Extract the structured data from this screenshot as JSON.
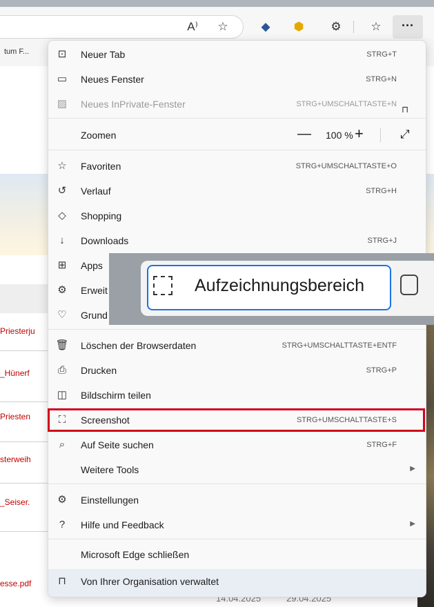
{
  "browser": {
    "favorite_item": "tum F...",
    "toolbar_icons": [
      "read-aloud-icon",
      "favorite-star-icon",
      "extension-icon",
      "extension-badge-icon",
      "extensions-icon",
      "favorites-icon"
    ],
    "more_label": "···"
  },
  "page": {
    "links": [
      "Priesterju",
      "_Hünerf",
      "Priesten",
      "sterweih",
      "_Seiser.",
      "esse.pdf"
    ],
    "dates": [
      "14.04.2025",
      "29.04.2025"
    ]
  },
  "menu": {
    "items": [
      {
        "label": "Neuer Tab",
        "shortcut": "STRG+T",
        "icon": "new-tab-icon"
      },
      {
        "label": "Neues Fenster",
        "shortcut": "STRG+N",
        "icon": "new-window-icon"
      },
      {
        "label": "Neues InPrivate-Fenster",
        "shortcut": "STRG+UMSCHALTTASTE+N",
        "icon": "inprivate-icon"
      },
      {
        "label": "Favoriten",
        "shortcut": "STRG+UMSCHALTTASTE+O",
        "icon": "favorites-icon"
      },
      {
        "label": "Verlauf",
        "shortcut": "STRG+H",
        "icon": "history-icon"
      },
      {
        "label": "Shopping",
        "shortcut": "",
        "icon": "shopping-tag-icon"
      },
      {
        "label": "Downloads",
        "shortcut": "STRG+J",
        "icon": "download-icon"
      },
      {
        "label": "Apps",
        "shortcut": "",
        "icon": "apps-icon"
      },
      {
        "label": "Erweit",
        "shortcut": "",
        "icon": "extensions-icon"
      },
      {
        "label": "Grund",
        "shortcut": "",
        "icon": "essentials-icon"
      },
      {
        "label": "Löschen der Browserdaten",
        "shortcut": "STRG+UMSCHALTTASTE+ENTF",
        "icon": "trash-icon"
      },
      {
        "label": "Drucken",
        "shortcut": "STRG+P",
        "icon": "printer-icon"
      },
      {
        "label": "Bildschirm teilen",
        "shortcut": "",
        "icon": "share-screen-icon"
      },
      {
        "label": "Screenshot",
        "shortcut": "STRG+UMSCHALTTASTE+S",
        "icon": "screenshot-icon"
      },
      {
        "label": "Auf Seite suchen",
        "shortcut": "STRG+F",
        "icon": "find-on-page-icon"
      },
      {
        "label": "Weitere Tools",
        "shortcut": "",
        "icon": ""
      },
      {
        "label": "Einstellungen",
        "shortcut": "",
        "icon": "settings-gear-icon"
      },
      {
        "label": "Hilfe und Feedback",
        "shortcut": "",
        "icon": "help-icon"
      },
      {
        "label": "Microsoft Edge schließen",
        "shortcut": "",
        "icon": ""
      },
      {
        "label": "Von Ihrer Organisation verwaltet",
        "shortcut": "",
        "icon": "briefcase-icon"
      }
    ],
    "zoom": {
      "label": "Zoomen",
      "minus": "—",
      "value": "100 %",
      "plus": "+"
    }
  },
  "popup": {
    "label": "Aufzeichnungsbereich"
  },
  "colors": {
    "highlight": "#d0021b",
    "popup_border": "#1a73e8",
    "link": "#c00000"
  }
}
